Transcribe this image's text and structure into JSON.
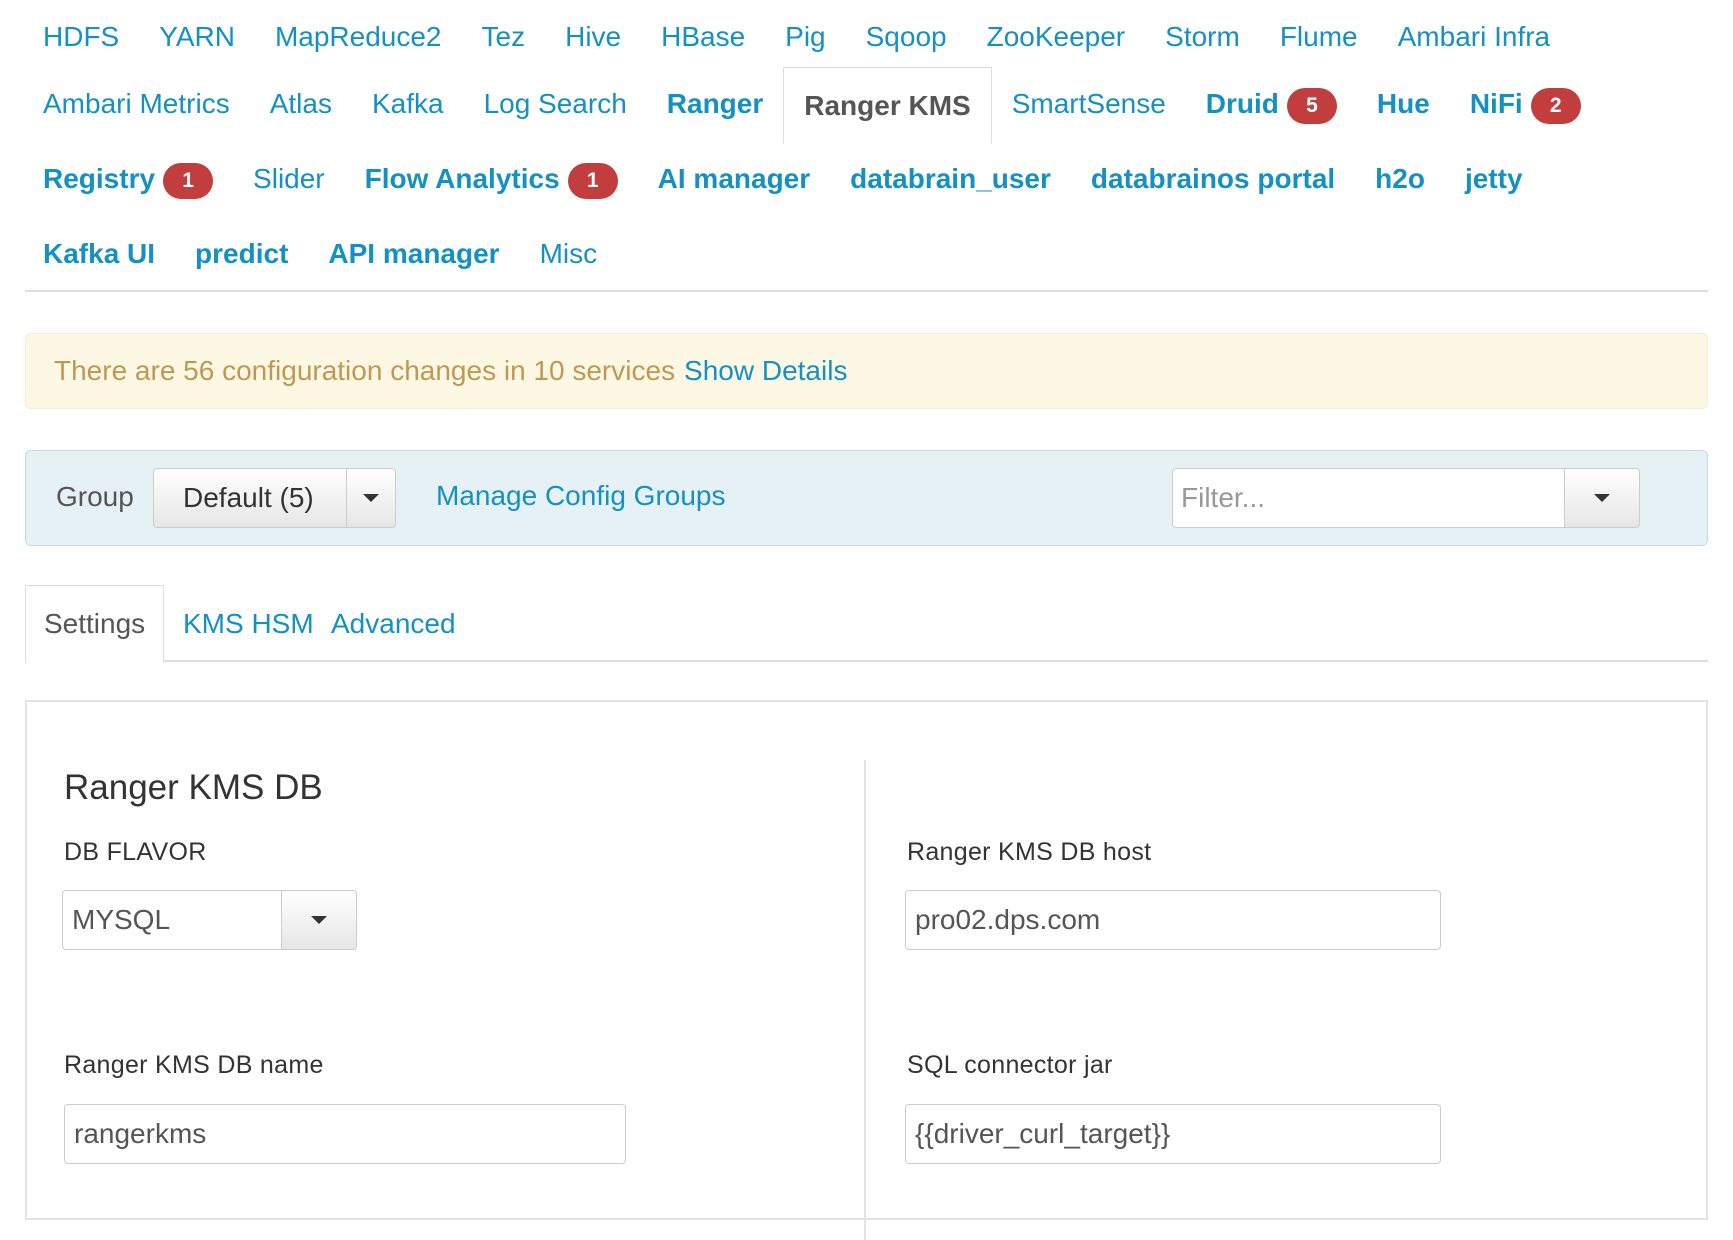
{
  "services": {
    "row1": [
      {
        "label": "HDFS"
      },
      {
        "label": "YARN"
      },
      {
        "label": "MapReduce2"
      },
      {
        "label": "Tez"
      },
      {
        "label": "Hive"
      },
      {
        "label": "HBase"
      },
      {
        "label": "Pig"
      },
      {
        "label": "Sqoop"
      },
      {
        "label": "ZooKeeper"
      },
      {
        "label": "Storm"
      },
      {
        "label": "Flume"
      },
      {
        "label": "Ambari Infra"
      }
    ],
    "row2": [
      {
        "label": "Ambari Metrics"
      },
      {
        "label": "Atlas"
      },
      {
        "label": "Kafka"
      },
      {
        "label": "Log Search"
      },
      {
        "label": "Ranger"
      },
      {
        "label": "Ranger KMS"
      },
      {
        "label": "SmartSense"
      },
      {
        "label": "Druid",
        "badge": "5"
      },
      {
        "label": "Hue"
      },
      {
        "label": "NiFi",
        "badge": "2"
      }
    ],
    "row3": [
      {
        "label": "Registry",
        "badge": "1"
      },
      {
        "label": "Slider"
      },
      {
        "label": "Flow Analytics",
        "badge": "1"
      },
      {
        "label": "AI manager"
      },
      {
        "label": "databrain_user"
      },
      {
        "label": "databrainos portal"
      },
      {
        "label": "h2o"
      },
      {
        "label": "jetty"
      }
    ],
    "row4": [
      {
        "label": "Kafka UI"
      },
      {
        "label": "predict"
      },
      {
        "label": "API manager"
      },
      {
        "label": "Misc"
      }
    ]
  },
  "alert": {
    "text": "There are 56 configuration changes in 10 services",
    "link": "Show Details"
  },
  "group_bar": {
    "label": "Group",
    "selected": "Default (5)",
    "manage_link": "Manage Config Groups",
    "filter_placeholder": "Filter..."
  },
  "sub_tabs": [
    {
      "label": "Settings"
    },
    {
      "label": "KMS HSM"
    },
    {
      "label": "Advanced"
    }
  ],
  "panel": {
    "title": "Ranger KMS DB",
    "db_flavor_label": "DB FLAVOR",
    "db_flavor_value": "MYSQL",
    "db_host_label": "Ranger KMS DB host",
    "db_host_value": "pro02.dps.com",
    "db_name_label": "Ranger KMS DB name",
    "db_name_value": "rangerkms",
    "sql_jar_label": "SQL connector jar",
    "sql_jar_value": "{{driver_curl_target}}"
  },
  "colors": {
    "link": "#1491c1",
    "badge": "#c23d3d",
    "alert_bg": "#fcf8e3",
    "alert_text": "#c09853",
    "group_bar_bg": "#e6f1f6"
  }
}
